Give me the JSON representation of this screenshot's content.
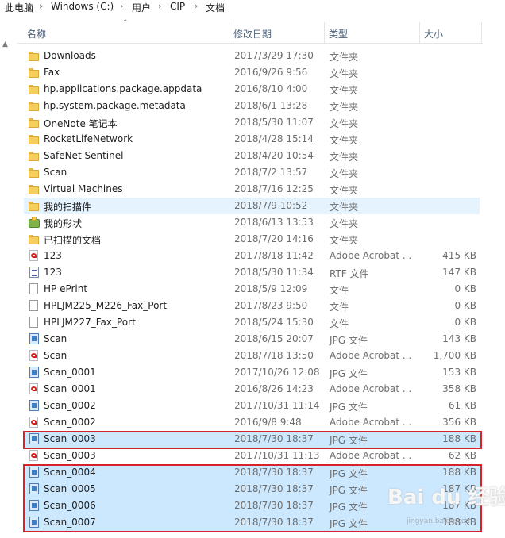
{
  "breadcrumb": [
    "此电脑",
    "Windows (C:)",
    "用户",
    "CIP",
    "文档"
  ],
  "columns": {
    "name": "名称",
    "date": "修改日期",
    "type": "类型",
    "size": "大小"
  },
  "files": [
    {
      "name": "Downloads",
      "date": "2017/3/29 17:30",
      "type": "文件夹",
      "size": "",
      "icon": "folder-icon"
    },
    {
      "name": "Fax",
      "date": "2016/9/26 9:56",
      "type": "文件夹",
      "size": "",
      "icon": "folder-icon"
    },
    {
      "name": "hp.applications.package.appdata",
      "date": "2016/8/10 4:00",
      "type": "文件夹",
      "size": "",
      "icon": "folder-icon"
    },
    {
      "name": "hp.system.package.metadata",
      "date": "2018/6/1 13:28",
      "type": "文件夹",
      "size": "",
      "icon": "folder-icon"
    },
    {
      "name": "OneNote 笔记本",
      "date": "2018/5/30 11:07",
      "type": "文件夹",
      "size": "",
      "icon": "folder-icon"
    },
    {
      "name": "RocketLifeNetwork",
      "date": "2018/4/28 15:14",
      "type": "文件夹",
      "size": "",
      "icon": "folder-icon"
    },
    {
      "name": "SafeNet Sentinel",
      "date": "2018/4/20 10:54",
      "type": "文件夹",
      "size": "",
      "icon": "folder-icon"
    },
    {
      "name": "Scan",
      "date": "2018/7/2 13:57",
      "type": "文件夹",
      "size": "",
      "icon": "folder-icon"
    },
    {
      "name": "Virtual Machines",
      "date": "2018/7/16 12:25",
      "type": "文件夹",
      "size": "",
      "icon": "folder-icon"
    },
    {
      "name": "我的扫描件",
      "date": "2018/7/9 10:52",
      "type": "文件夹",
      "size": "",
      "icon": "folder-icon"
    },
    {
      "name": "我的形状",
      "date": "2018/6/13 13:53",
      "type": "文件夹",
      "size": "",
      "icon": "shapes-folder-icon"
    },
    {
      "name": "已扫描的文档",
      "date": "2018/7/20 14:16",
      "type": "文件夹",
      "size": "",
      "icon": "folder-icon"
    },
    {
      "name": "123",
      "date": "2017/8/18 11:42",
      "type": "Adobe Acrobat ...",
      "size": "415 KB",
      "icon": "pdf-icon"
    },
    {
      "name": "123",
      "date": "2018/5/30 11:34",
      "type": "RTF 文件",
      "size": "147 KB",
      "icon": "rtf-icon"
    },
    {
      "name": "HP ePrint",
      "date": "2018/5/9 12:09",
      "type": "文件",
      "size": "0 KB",
      "icon": "file-icon"
    },
    {
      "name": "HPLJM225_M226_Fax_Port",
      "date": "2017/8/23 9:50",
      "type": "文件",
      "size": "0 KB",
      "icon": "file-icon"
    },
    {
      "name": "HPLJM227_Fax_Port",
      "date": "2018/5/24 15:30",
      "type": "文件",
      "size": "0 KB",
      "icon": "file-icon"
    },
    {
      "name": "Scan",
      "date": "2018/6/15 20:07",
      "type": "JPG 文件",
      "size": "143 KB",
      "icon": "jpg-icon"
    },
    {
      "name": "Scan",
      "date": "2018/7/18 13:50",
      "type": "Adobe Acrobat ...",
      "size": "1,700 KB",
      "icon": "pdf-icon"
    },
    {
      "name": "Scan_0001",
      "date": "2017/10/26 12:08",
      "type": "JPG 文件",
      "size": "153 KB",
      "icon": "jpg-icon"
    },
    {
      "name": "Scan_0001",
      "date": "2016/8/26 14:23",
      "type": "Adobe Acrobat ...",
      "size": "358 KB",
      "icon": "pdf-icon"
    },
    {
      "name": "Scan_0002",
      "date": "2017/10/31 11:14",
      "type": "JPG 文件",
      "size": "61 KB",
      "icon": "jpg-icon"
    },
    {
      "name": "Scan_0002",
      "date": "2016/9/8 9:48",
      "type": "Adobe Acrobat ...",
      "size": "356 KB",
      "icon": "pdf-icon"
    },
    {
      "name": "Scan_0003",
      "date": "2018/7/30 18:37",
      "type": "JPG 文件",
      "size": "188 KB",
      "icon": "jpg-icon"
    },
    {
      "name": "Scan_0003",
      "date": "2017/10/31 11:13",
      "type": "Adobe Acrobat ...",
      "size": "62 KB",
      "icon": "pdf-icon"
    },
    {
      "name": "Scan_0004",
      "date": "2018/7/30 18:37",
      "type": "JPG 文件",
      "size": "188 KB",
      "icon": "jpg-icon"
    },
    {
      "name": "Scan_0005",
      "date": "2018/7/30 18:37",
      "type": "JPG 文件",
      "size": "187 KB",
      "icon": "jpg-icon"
    },
    {
      "name": "Scan_0006",
      "date": "2018/7/30 18:37",
      "type": "JPG 文件",
      "size": "187 KB",
      "icon": "jpg-icon"
    },
    {
      "name": "Scan_0007",
      "date": "2018/7/30 18:37",
      "type": "JPG 文件",
      "size": "188 KB",
      "icon": "jpg-icon"
    }
  ],
  "selected_rows": [
    23,
    25,
    26,
    27,
    28
  ],
  "hover_row": 9,
  "highlight_color": "#d8222a",
  "selection_color": "#cce8ff",
  "watermark": "Bai du 经验",
  "watermark_sub": "jingyan.baidu.com"
}
